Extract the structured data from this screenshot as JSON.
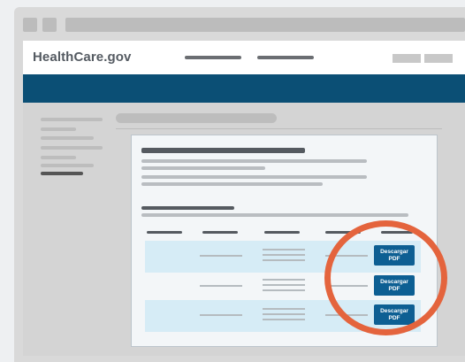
{
  "header": {
    "logo": "HealthCare.gov"
  },
  "table": {
    "rows": [
      {
        "button": {
          "line1": "Descargar",
          "line2": "PDF"
        },
        "highlight": true
      },
      {
        "button": {
          "line1": "Descargar",
          "line2": "PDF"
        },
        "highlight": false
      },
      {
        "button": {
          "line1": "Descargar",
          "line2": "PDF"
        },
        "highlight": true
      }
    ]
  },
  "colors": {
    "brand_navy": "#0b4f75",
    "button_blue": "#0d5f93",
    "row_highlight": "#d6ecf6",
    "annotation_ring": "#e4643d"
  },
  "icons": []
}
